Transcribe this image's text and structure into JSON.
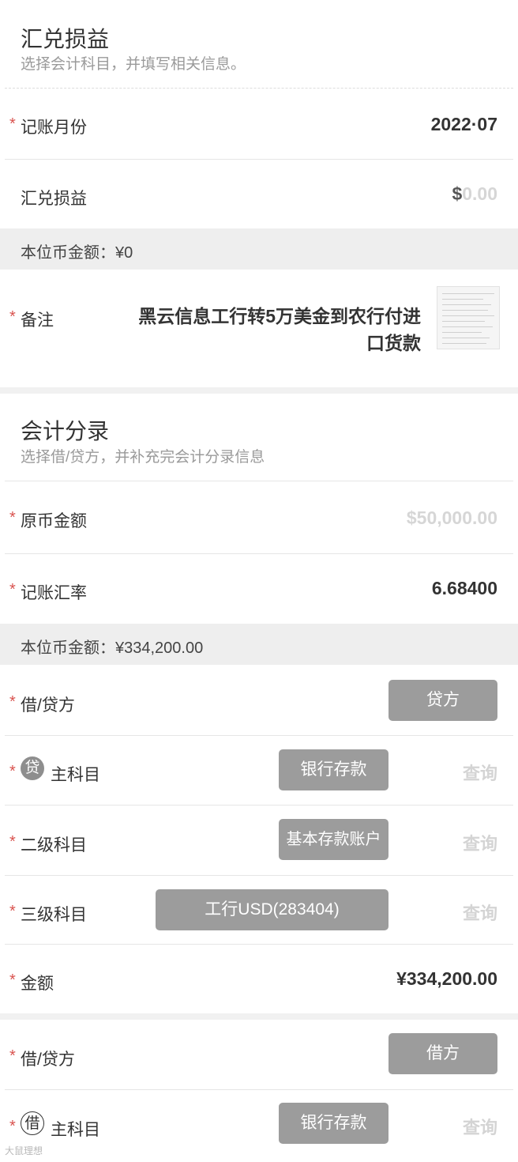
{
  "section1": {
    "title": "汇兑损益",
    "subtitle": "选择会计科目，并填写相关信息。"
  },
  "fields": {
    "month_label": "记账月份",
    "month_value": "2022·07",
    "fx_label": "汇兑损益",
    "fx_currency": "$",
    "fx_placeholder": "0.00",
    "local_amount_band": "本位币金额：¥0",
    "note_label": "备注",
    "note_value": "黑云信息工行转5万美金到农行付进口货款"
  },
  "section2": {
    "title": "会计分录",
    "subtitle": "选择借/贷方，并补充完会计分录信息"
  },
  "entry": {
    "orig_label": "原币金额",
    "orig_placeholder": "$50,000.00",
    "rate_label": "记账汇率",
    "rate_value": "6.68400",
    "local_band": "本位币金额：¥334,200.00"
  },
  "entry1": {
    "side_label": "借/贷方",
    "side_value": "贷方",
    "main_icon": "贷",
    "main_label": "主科目",
    "main_value": "银行存款",
    "query": "查询",
    "sub2_label": "二级科目",
    "sub2_value": "基本存款账户",
    "sub3_label": "三级科目",
    "sub3_value": "工行USD(283404)",
    "amount_label": "金额",
    "amount_value": "¥334,200.00"
  },
  "entry2": {
    "side_label": "借/贷方",
    "side_value": "借方",
    "main_icon": "借",
    "main_label": "主科目",
    "main_value": "银行存款",
    "query": "查询"
  },
  "watermark": "大鼠理想",
  "colors": {
    "required_star": "#d9534f",
    "button_bg": "#9c9c9c",
    "band_bg": "#eeeeee",
    "placeholder": "#d6d6d6"
  }
}
